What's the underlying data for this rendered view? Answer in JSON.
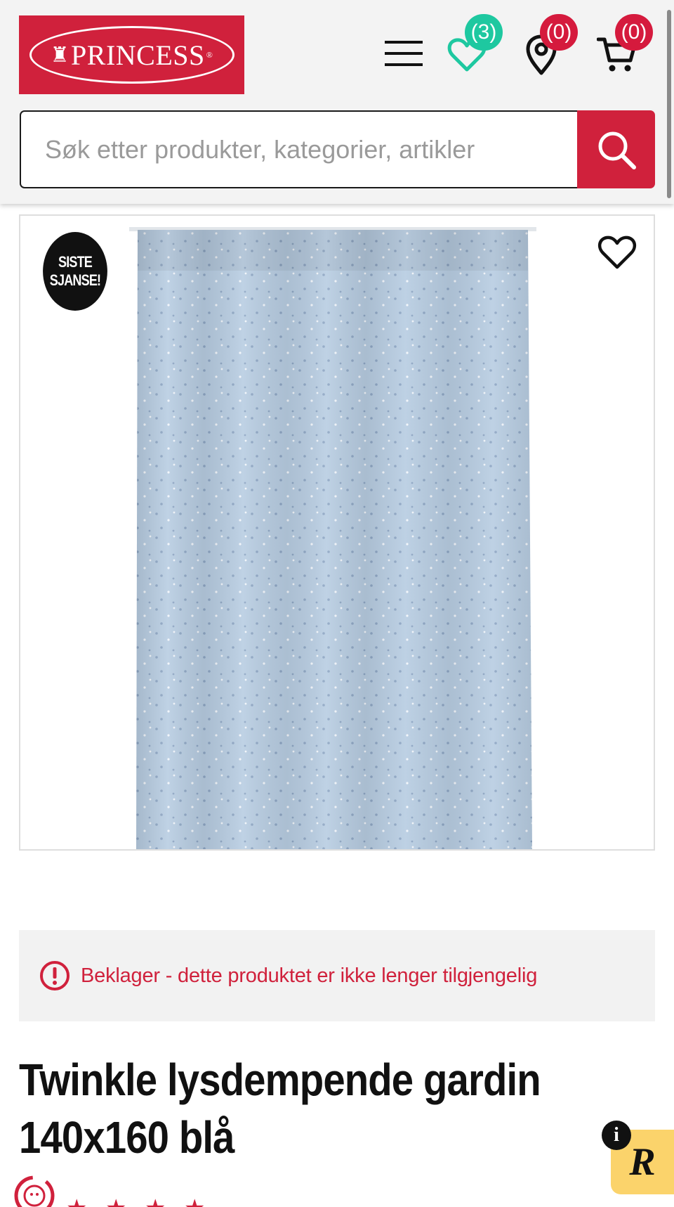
{
  "header": {
    "logo_text": "PRINCESS",
    "logo_reg": "®",
    "wishlist_count": "(3)",
    "stores_count": "(0)",
    "cart_count": "(0)"
  },
  "search": {
    "placeholder": "Søk etter produkter, kategorier, artikler"
  },
  "product": {
    "tag_line1": "SISTE",
    "tag_line2": "SJANSE!",
    "unavailable_notice": "Beklager - dette produktet er ikke lenger tilgjengelig",
    "title": "Twinkle lysdempende gardin 140x160 blå",
    "rating_stars_visible": 4
  },
  "widgets": {
    "info_label": "i",
    "reviews_badge": "R"
  },
  "colors": {
    "brand_red": "#d0213c",
    "wishlist_badge": "#1ec8a0",
    "curtain_blue": "#b8cde2",
    "review_badge_yellow": "#fbd36b"
  },
  "icons": [
    "menu-icon",
    "heart-icon",
    "location-pin-icon",
    "cart-icon",
    "search-icon",
    "heart-outline-icon",
    "alert-circle-icon",
    "info-icon"
  ]
}
